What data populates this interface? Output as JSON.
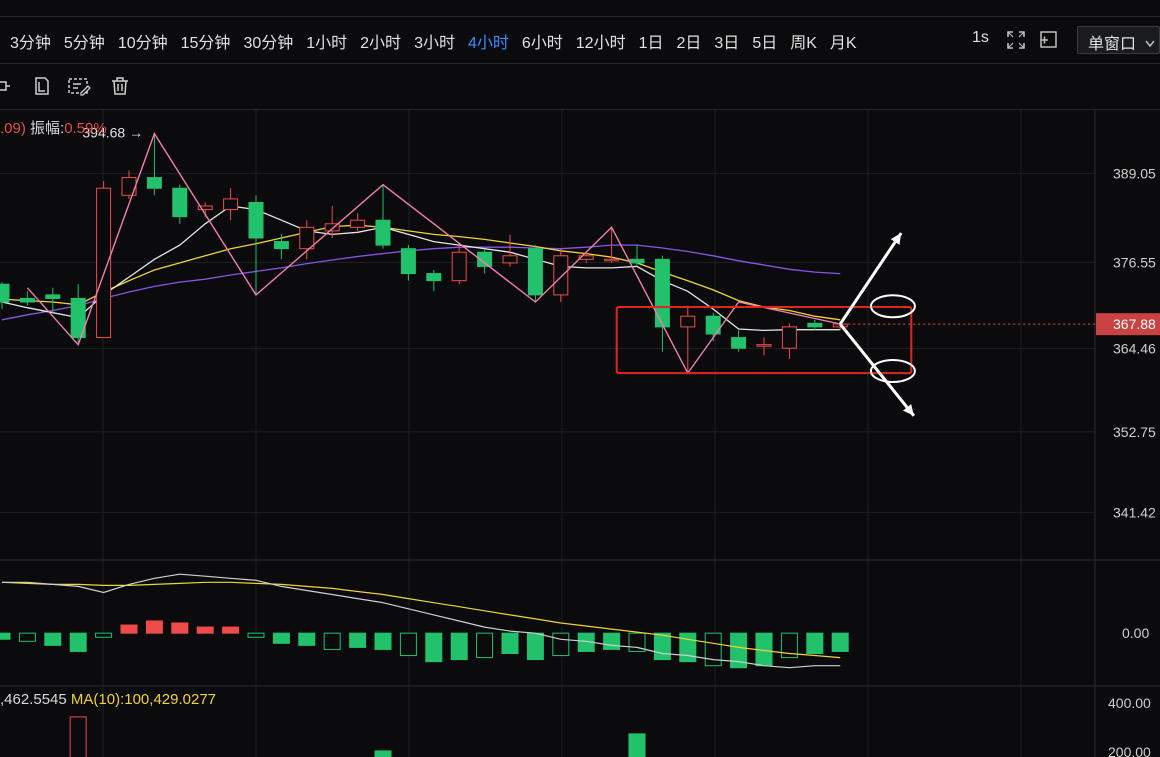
{
  "toolbar": {
    "timeframes": [
      "3分钟",
      "5分钟",
      "10分钟",
      "15分钟",
      "30分钟",
      "1小时",
      "2小时",
      "3小时",
      "4小时",
      "6小时",
      "12小时",
      "1日",
      "2日",
      "3日",
      "5日",
      "周K",
      "月K"
    ],
    "active_timeframe": "4小时",
    "interval_1s": "1s",
    "window_mode": "单窗口"
  },
  "chart_info": {
    "partial_value": ".09)",
    "amplitude_label": "振幅:",
    "amplitude_value": "0.59%",
    "high_marker": "394.68"
  },
  "volume_ma": {
    "ma5_partial": ",462.5545",
    "ma10": "MA(10):100,429.0277"
  },
  "colors": {
    "up": "#f04b4b",
    "down": "#22c16b",
    "ma_white": "#e6e6e6",
    "ma_yellow": "#f0d33a",
    "ma_purple": "#8a55e6",
    "zigzag_pink": "#ef7fae",
    "box_red": "#e0261f",
    "active_blue": "#3d8bfd"
  },
  "chart_data": [
    {
      "type": "candlestick",
      "current_price": "367.88",
      "y_ticks": [
        "389.05",
        "376.55",
        "364.46",
        "352.75",
        "341.42"
      ],
      "ylim": [
        335,
        398
      ],
      "candles": [
        {
          "o": 373.5,
          "c": 371.0,
          "h": 373.8,
          "l": 370.0
        },
        {
          "o": 371.5,
          "c": 371.0,
          "h": 372.5,
          "l": 370.5
        },
        {
          "o": 372.0,
          "c": 371.5,
          "h": 373.0,
          "l": 369.5
        },
        {
          "o": 371.5,
          "c": 366.0,
          "h": 373.5,
          "l": 365.0
        },
        {
          "o": 366.0,
          "c": 387.0,
          "h": 388.0,
          "l": 366.0
        },
        {
          "o": 386.0,
          "c": 388.5,
          "h": 389.5,
          "l": 385.5
        },
        {
          "o": 388.5,
          "c": 387.0,
          "h": 394.68,
          "l": 386.0
        },
        {
          "o": 387.0,
          "c": 383.0,
          "h": 387.5,
          "l": 382.0
        },
        {
          "o": 384.0,
          "c": 384.5,
          "h": 385.0,
          "l": 383.0
        },
        {
          "o": 384.0,
          "c": 385.5,
          "h": 387.0,
          "l": 382.5
        },
        {
          "o": 385.0,
          "c": 380.0,
          "h": 386.0,
          "l": 372.0
        },
        {
          "o": 379.5,
          "c": 378.5,
          "h": 380.5,
          "l": 377.0
        },
        {
          "o": 378.5,
          "c": 381.5,
          "h": 382.5,
          "l": 377.0
        },
        {
          "o": 381.0,
          "c": 382.0,
          "h": 384.5,
          "l": 380.0
        },
        {
          "o": 381.5,
          "c": 382.5,
          "h": 383.5,
          "l": 381.0
        },
        {
          "o": 382.5,
          "c": 379.0,
          "h": 387.5,
          "l": 378.5
        },
        {
          "o": 378.5,
          "c": 375.0,
          "h": 379.0,
          "l": 374.0
        },
        {
          "o": 375.0,
          "c": 374.0,
          "h": 375.5,
          "l": 372.5
        },
        {
          "o": 374.0,
          "c": 378.0,
          "h": 379.0,
          "l": 373.5
        },
        {
          "o": 378.0,
          "c": 376.0,
          "h": 378.5,
          "l": 375.0
        },
        {
          "o": 376.5,
          "c": 377.5,
          "h": 380.5,
          "l": 376.0
        },
        {
          "o": 378.5,
          "c": 372.0,
          "h": 379.0,
          "l": 371.0
        },
        {
          "o": 372.0,
          "c": 377.5,
          "h": 378.5,
          "l": 371.0
        },
        {
          "o": 377.0,
          "c": 377.5,
          "h": 378.0,
          "l": 376.5
        },
        {
          "o": 377.0,
          "c": 377.0,
          "h": 381.5,
          "l": 376.5
        },
        {
          "o": 377.0,
          "c": 376.5,
          "h": 379.0,
          "l": 376.0
        },
        {
          "o": 377.0,
          "c": 367.5,
          "h": 377.5,
          "l": 364.0
        },
        {
          "o": 367.5,
          "c": 369.0,
          "h": 370.5,
          "l": 361.0
        },
        {
          "o": 369.0,
          "c": 366.5,
          "h": 369.5,
          "l": 365.5
        },
        {
          "o": 366.0,
          "c": 364.5,
          "h": 367.0,
          "l": 364.0
        },
        {
          "o": 365.0,
          "c": 365.0,
          "h": 366.0,
          "l": 363.5
        },
        {
          "o": 364.5,
          "c": 367.5,
          "h": 368.0,
          "l": 363.0
        },
        {
          "o": 368.0,
          "c": 367.5,
          "h": 368.5,
          "l": 367.0
        },
        {
          "o": 367.5,
          "c": 367.9,
          "h": 368.3,
          "l": 367.0
        }
      ],
      "ma_white": [
        371,
        370.2,
        369.5,
        368.8,
        372,
        374.5,
        377,
        379,
        382,
        384.5,
        384,
        382.5,
        381,
        380.5,
        380.8,
        381.5,
        380.5,
        379.5,
        379,
        378.5,
        378,
        377,
        376,
        375.8,
        375.8,
        376,
        374,
        372.5,
        370,
        367.2,
        367,
        367.1,
        367.1,
        367.1
      ],
      "ma_yellow": [
        371.4,
        371.2,
        371,
        370.6,
        372.4,
        374,
        375.5,
        376.5,
        377.5,
        378.5,
        379.2,
        380,
        380.8,
        381.6,
        381.8,
        381.5,
        381,
        380.5,
        380.2,
        379.8,
        379.3,
        378.8,
        378.2,
        377.8,
        377.3,
        376.5,
        375.2,
        374,
        372.7,
        371.2,
        370.3,
        369.8,
        369,
        368.5
      ],
      "ma_purple": [
        368.5,
        369.2,
        369.8,
        370.5,
        371.5,
        372.4,
        373.2,
        373.8,
        374.2,
        374.8,
        375.3,
        375.8,
        376.4,
        376.9,
        377.4,
        377.8,
        378.2,
        378.5,
        378.7,
        378.7,
        378.7,
        378.6,
        378.5,
        378.7,
        379,
        379,
        378.6,
        378.1,
        377.5,
        376.8,
        376.2,
        375.6,
        375.2,
        375
      ],
      "zigzag": [
        [
          1,
          373
        ],
        [
          3,
          365
        ],
        [
          6,
          394.68
        ],
        [
          10,
          372
        ],
        [
          15,
          387.5
        ],
        [
          21,
          371
        ],
        [
          24,
          381.5
        ],
        [
          27,
          361
        ],
        [
          29,
          371
        ],
        [
          33,
          367.9
        ]
      ],
      "consolidation_box": {
        "top": 370.3,
        "bottom": 361.0,
        "from_index": 24.2,
        "to_index": 35.8
      },
      "ellipses": [
        {
          "index": 34.8,
          "price": 370.4
        },
        {
          "index": 34.8,
          "price": 361.3
        }
      ],
      "arrows": [
        {
          "from": [
            33,
            367.9
          ],
          "to": [
            35.4,
            380.7
          ]
        },
        {
          "from": [
            33,
            367.9
          ],
          "to": [
            35.9,
            355.0
          ]
        }
      ]
    },
    {
      "type": "macd",
      "zero_label": "0.00",
      "hist": [
        -0.3,
        -0.4,
        -0.6,
        -0.9,
        -0.2,
        0.4,
        0.6,
        0.5,
        0.3,
        0.3,
        -0.2,
        -0.5,
        -0.6,
        -0.8,
        -0.7,
        -0.8,
        -1.1,
        -1.4,
        -1.3,
        -1.2,
        -1.0,
        -1.3,
        -1.1,
        -0.9,
        -0.8,
        -0.9,
        -1.3,
        -1.4,
        -1.6,
        -1.7,
        -1.6,
        -1.2,
        -1.0,
        -0.9
      ],
      "line_dif": [
        2.5,
        2.5,
        2.4,
        2.3,
        2.0,
        2.4,
        2.7,
        2.9,
        2.8,
        2.7,
        2.6,
        2.3,
        2.1,
        1.9,
        1.7,
        1.5,
        1.2,
        0.9,
        0.6,
        0.3,
        0.1,
        0.0,
        -0.3,
        -0.4,
        -0.6,
        -0.7,
        -1.0,
        -1.1,
        -1.3,
        -1.4,
        -1.6,
        -1.7,
        -1.6,
        -1.6
      ],
      "line_dea": [
        2.5,
        2.45,
        2.4,
        2.4,
        2.35,
        2.35,
        2.4,
        2.45,
        2.5,
        2.5,
        2.45,
        2.4,
        2.3,
        2.2,
        2.05,
        1.9,
        1.7,
        1.5,
        1.3,
        1.1,
        0.9,
        0.7,
        0.5,
        0.35,
        0.2,
        0.05,
        -0.1,
        -0.3,
        -0.5,
        -0.7,
        -0.85,
        -1.0,
        -1.1,
        -1.2
      ],
      "ylim": [
        -2.5,
        3.5
      ]
    },
    {
      "type": "volume",
      "y_ticks": [
        "400.00",
        "200.00"
      ],
      "visible_bars": [
        {
          "index": 3,
          "value": 430,
          "up": true
        },
        {
          "index": 9,
          "value": 190,
          "up": false
        },
        {
          "index": 15,
          "value": 230,
          "up": false
        },
        {
          "index": 25,
          "value": 330,
          "up": false
        },
        {
          "index": 26,
          "value": 180,
          "up": true
        }
      ]
    }
  ]
}
